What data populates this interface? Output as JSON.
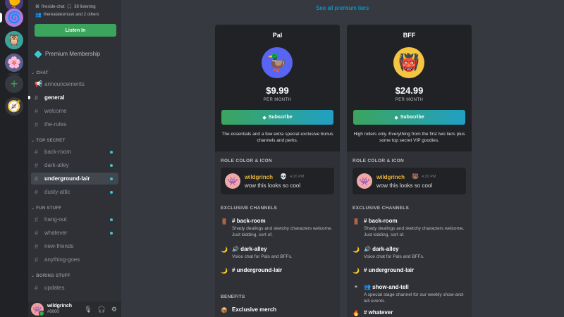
{
  "sidebar": {
    "stage_channel": "fireside-chat",
    "listening": "38 listening",
    "participants": "therealalexmusk and 2 others",
    "listen_in_label": "Listen In",
    "premium_label": "Premium Membership",
    "categories": [
      {
        "name": "CHAT",
        "channels": [
          {
            "name": "announcements",
            "icon": "megaphone-icon"
          },
          {
            "name": "general",
            "active": true
          },
          {
            "name": "welcome"
          },
          {
            "name": "the-rules"
          }
        ]
      },
      {
        "name": "TOP SECRET",
        "channels": [
          {
            "name": "back-room",
            "locked": true
          },
          {
            "name": "dark-alley",
            "locked": true
          },
          {
            "name": "underground-lair",
            "locked": true,
            "active": true
          },
          {
            "name": "dusty-attic",
            "locked": true
          }
        ]
      },
      {
        "name": "FUN STUFF",
        "channels": [
          {
            "name": "hang-out",
            "locked": true
          },
          {
            "name": "whatever",
            "locked": true
          },
          {
            "name": "new-friends"
          },
          {
            "name": "anything-goes"
          }
        ]
      },
      {
        "name": "BORING STUFF",
        "channels": [
          {
            "name": "updates"
          }
        ]
      }
    ]
  },
  "user": {
    "name": "wildgrinch",
    "tag": "#0000"
  },
  "main": {
    "see_all_label": "See all premium tiers",
    "tiers": [
      {
        "name": "Pal",
        "price": "$9.99",
        "per": "PER MONTH",
        "subscribe_label": "Subscribe",
        "description": "The essentials and a few extra special exclusive bonus channels and perks.",
        "role_section": "ROLE COLOR & ICON",
        "preview": {
          "name": "wildgrinch",
          "time": "4:20 PM",
          "message": "wow this looks so cool"
        },
        "channels_section": "EXCLUSIVE CHANNELS",
        "channels": [
          {
            "title": "# back-room",
            "desc": "Shady dealings and sketchy characters welcome. Just kidding, sort of."
          },
          {
            "title": "🔊 dark-alley",
            "desc": "Voice chat for Pals and BFFs."
          },
          {
            "title": "# underground-lair",
            "desc": ""
          }
        ],
        "benefits_section": "BENEFITS",
        "benefits": [
          {
            "title": "Exclusive merch"
          }
        ]
      },
      {
        "name": "BFF",
        "price": "$24.99",
        "per": "PER MONTH",
        "subscribe_label": "Subscribe",
        "description": "High rollers only. Everything from the first two tiers plus some top secret VIP goodies.",
        "role_section": "ROLE COLOR & ICON",
        "preview": {
          "name": "wildgrinch",
          "time": "4:20 PM",
          "message": "wow this looks so cool"
        },
        "channels_section": "EXCLUSIVE CHANNELS",
        "channels": [
          {
            "title": "# back-room",
            "desc": "Shady dealings and sketchy characters welcome. Just kidding, sort of."
          },
          {
            "title": "🔊 dark-alley",
            "desc": "Voice chat for Pals and BFFs."
          },
          {
            "title": "# underground-lair",
            "desc": ""
          },
          {
            "title": "👥 show-and-tell",
            "desc": "A special stage channel for our weekly show-and-tell events."
          },
          {
            "title": "# whatever",
            "desc": ""
          }
        ]
      }
    ]
  }
}
